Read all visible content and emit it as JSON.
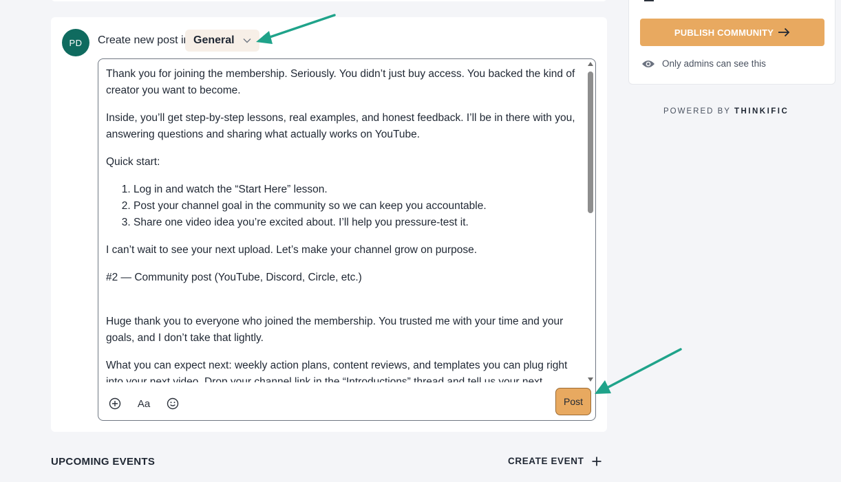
{
  "composer": {
    "avatar_initials": "PD",
    "create_label": "Create new post in",
    "space_selected": "General",
    "editor": {
      "paragraph_1": "Thank you for joining the membership. Seriously. You didn’t just buy access. You backed the kind of creator you want to become.",
      "paragraph_2": "Inside, you’ll get step-by-step lessons, real examples, and honest feedback. I’ll be in there with you, answering questions and sharing what actually works on YouTube.",
      "paragraph_3": "Quick start:",
      "list": [
        "Log in and watch the “Start Here” lesson.",
        "Post your channel goal in the community so we can keep you accountable.",
        "Share one video idea you’re excited about. I’ll help you pressure-test it."
      ],
      "paragraph_4": "I can’t wait to see your next upload. Let’s make your channel grow on purpose.",
      "paragraph_5": "#2 — Community post (YouTube, Discord, Circle, etc.)",
      "paragraph_6": "Huge thank you to everyone who joined the membership. You trusted me with your time and your goals, and I don’t take that lightly.",
      "paragraph_7": "What you can expect next: weekly action plans, content reviews, and templates you can plug right into your next video. Drop your channel link in the “Introductions” thread and tell us your next milestone."
    },
    "toolbar": {
      "add_icon": "plus-circle-icon",
      "format_label": "Aa",
      "emoji_icon": "smiley-icon"
    },
    "post_label": "Post"
  },
  "events": {
    "title": "UPCOMING EVENTS",
    "create_label": "CREATE EVENT"
  },
  "sidebar": {
    "publish_label": "PUBLISH COMMUNITY",
    "admin_note": "Only admins can see this",
    "powered_by_prefix": "POWERED BY ",
    "powered_by_brand": "THINKIFIC"
  },
  "colors": {
    "accent": "#e8a960",
    "avatar_bg": "#0f6b5f",
    "annotation_arrow": "#1fa38a",
    "page_bg": "#f4f5f8"
  }
}
